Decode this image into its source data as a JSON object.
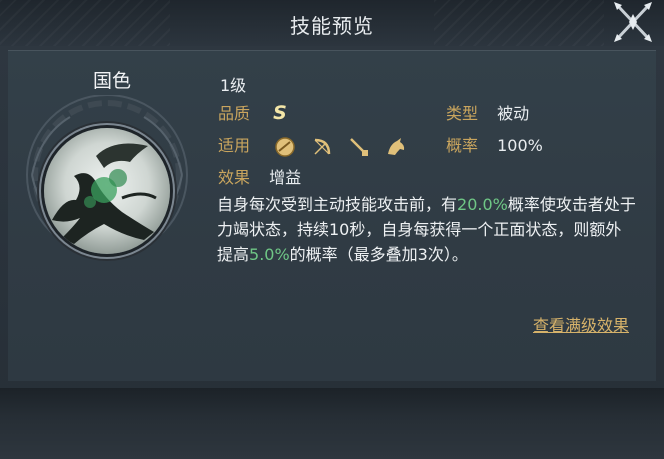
{
  "header": {
    "title": "技能预览"
  },
  "skill": {
    "name": "国色",
    "level": "1级",
    "grade_label": "品质",
    "grade_value": "S",
    "type_label": "类型",
    "type_value": "被动",
    "apply_label": "适用",
    "apply_icons": [
      "shield-icon",
      "bow-icon",
      "spear-icon",
      "horse-icon"
    ],
    "rate_label": "概率",
    "rate_value": "100%",
    "effect_label": "效果",
    "effect_value": "增益",
    "desc": {
      "p1": "自身每次受到主动技能攻击前，有",
      "h1": "20.0%",
      "p2": "概率使攻击者处于力竭状态，持续10秒，自身每获得一个正面状态，则额外提高",
      "h2": "5.0%",
      "p3": "的概率（最多叠加3次）。"
    },
    "max_link": "查看满级效果"
  },
  "colors": {
    "label": "#c9a55e",
    "highlight": "#6fc786",
    "link": "#d6b26a",
    "text": "#e9edf0"
  }
}
